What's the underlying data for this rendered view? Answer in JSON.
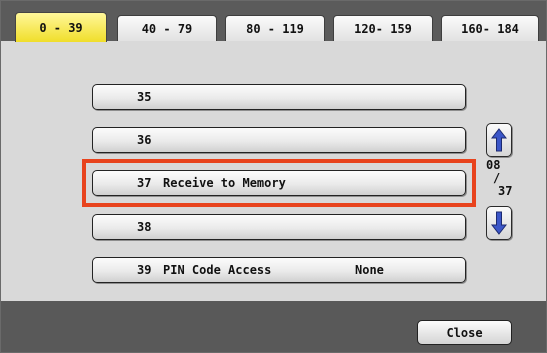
{
  "tabs": [
    {
      "label": "0 - 39",
      "active": true
    },
    {
      "label": "40 - 79",
      "active": false
    },
    {
      "label": "80 - 119",
      "active": false
    },
    {
      "label": "120- 159",
      "active": false
    },
    {
      "label": "160- 184",
      "active": false
    }
  ],
  "rows": [
    {
      "number": "35",
      "label": "",
      "value": ""
    },
    {
      "number": "36",
      "label": "",
      "value": ""
    },
    {
      "number": "37",
      "label": "Receive to Memory",
      "value": ""
    },
    {
      "number": "38",
      "label": "",
      "value": ""
    },
    {
      "number": "39",
      "label": "PIN Code Access",
      "value": "None"
    }
  ],
  "page_indicator": {
    "current": "08",
    "separator": "/",
    "total": "37"
  },
  "footer": {
    "close_label": "Close"
  },
  "icons": {
    "scroll_up": "arrow-up-icon",
    "scroll_down": "arrow-down-icon"
  },
  "colors": {
    "active_tab": "#f2e23a",
    "highlight": "#e8431d",
    "arrow": "#3b56c8",
    "tab_bar": "#5b5b5b",
    "footer": "#595959",
    "panel": "#d9d9d9"
  }
}
